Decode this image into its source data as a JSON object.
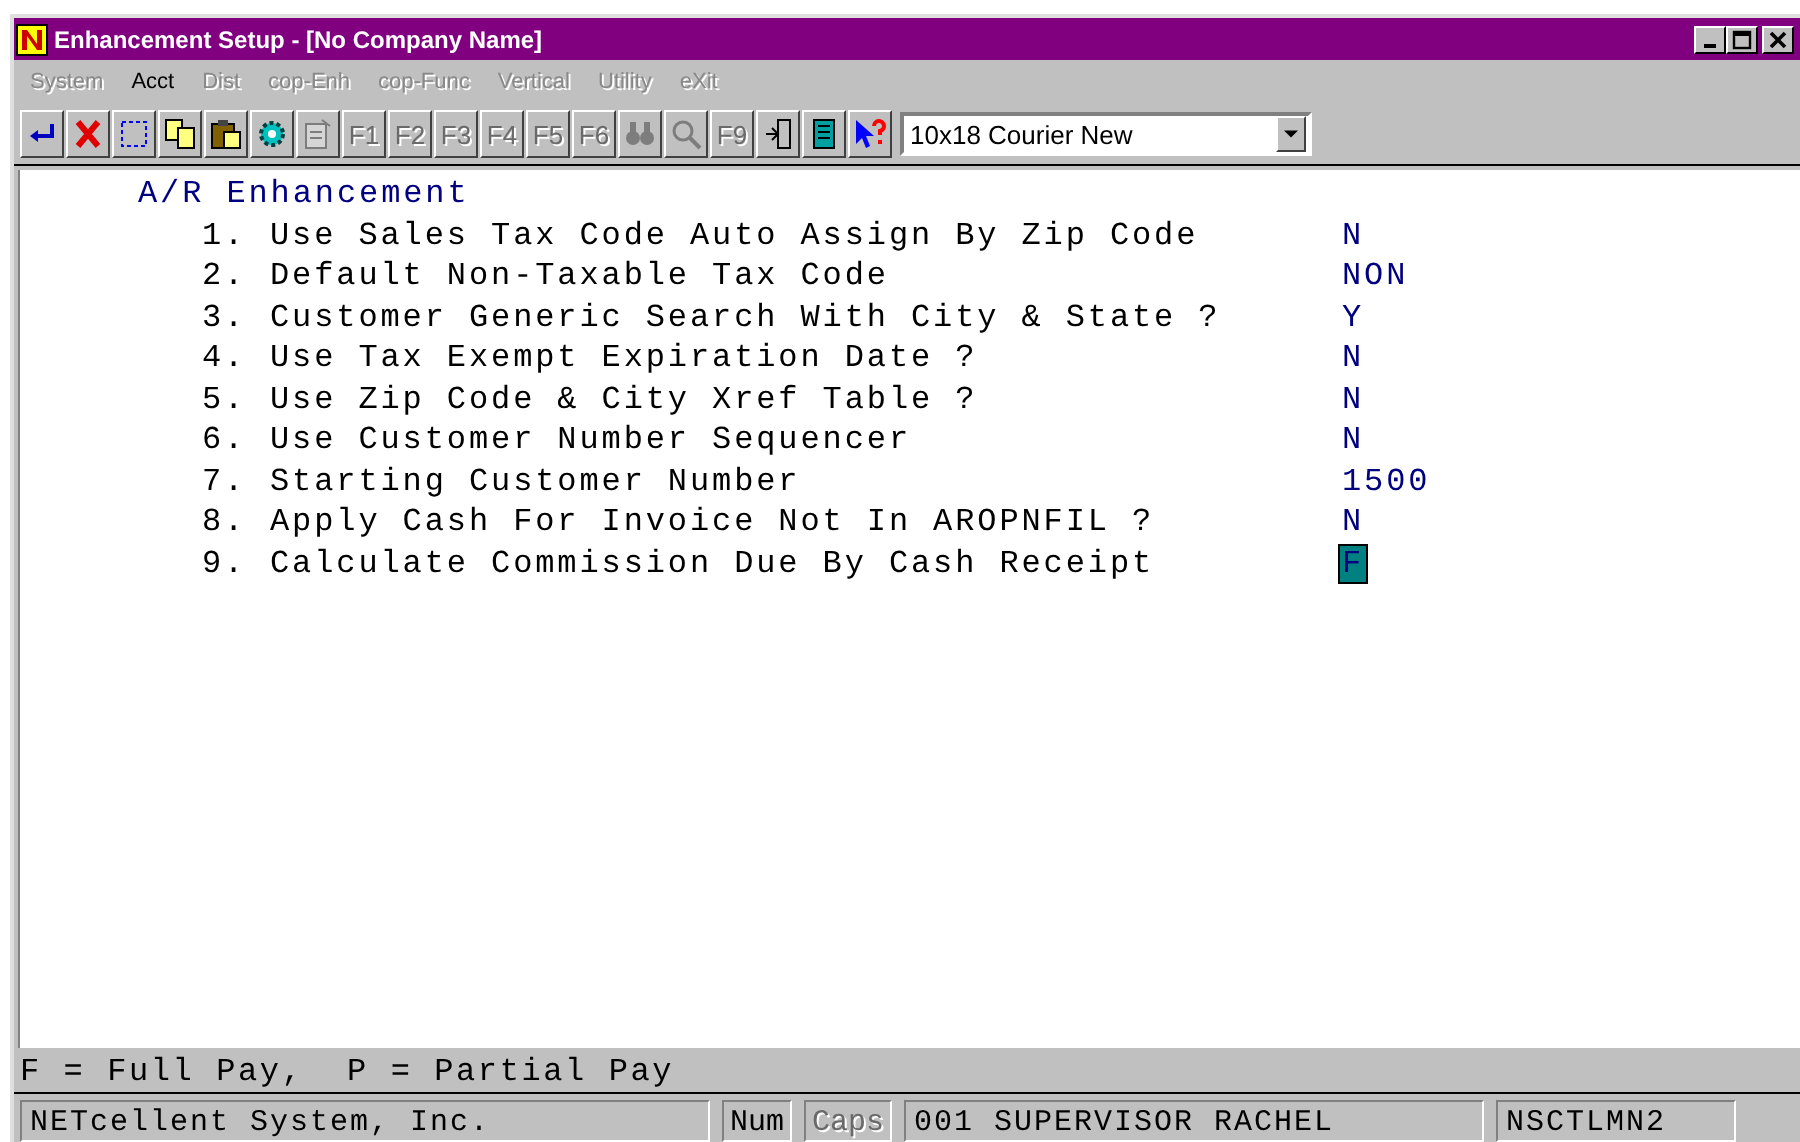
{
  "window": {
    "title": "Enhancement Setup - [No Company Name]"
  },
  "menu": [
    {
      "label": "System",
      "disabled": true
    },
    {
      "label": "Acct",
      "disabled": false
    },
    {
      "label": "Dist",
      "disabled": true
    },
    {
      "label": "cop-Enh",
      "disabled": true
    },
    {
      "label": "cop-Func",
      "disabled": true
    },
    {
      "label": "Vertical",
      "disabled": true
    },
    {
      "label": "Utility",
      "disabled": true
    },
    {
      "label": "eXit",
      "disabled": true
    }
  ],
  "toolbar": [
    {
      "kind": "enter",
      "disabled": false
    },
    {
      "kind": "cancel",
      "disabled": false
    },
    {
      "kind": "select",
      "disabled": false
    },
    {
      "kind": "copy",
      "disabled": false
    },
    {
      "kind": "paste",
      "disabled": false
    },
    {
      "kind": "gear",
      "disabled": false
    },
    {
      "kind": "document",
      "disabled": true
    },
    {
      "kind": "key",
      "label": "F1",
      "disabled": true
    },
    {
      "kind": "key",
      "label": "F2",
      "disabled": true
    },
    {
      "kind": "key",
      "label": "F3",
      "disabled": true
    },
    {
      "kind": "key",
      "label": "F4",
      "disabled": true
    },
    {
      "kind": "key",
      "label": "F5",
      "disabled": true
    },
    {
      "kind": "key",
      "label": "F6",
      "disabled": true
    },
    {
      "kind": "binoculars",
      "disabled": true
    },
    {
      "kind": "magnifier",
      "disabled": true
    },
    {
      "kind": "key",
      "label": "F9",
      "disabled": true
    },
    {
      "kind": "exit",
      "disabled": false
    },
    {
      "kind": "notebook",
      "disabled": false
    },
    {
      "kind": "help",
      "disabled": false
    }
  ],
  "font_select": {
    "value": "10x18 Courier New"
  },
  "form": {
    "heading": "A/R Enhancement",
    "fields": [
      {
        "number": "1.",
        "label": "Use Sales Tax Code Auto Assign By Zip Code",
        "value": "N",
        "selected": false
      },
      {
        "number": "2.",
        "label": "Default Non-Taxable Tax Code",
        "value": "NON",
        "selected": false
      },
      {
        "number": "3.",
        "label": "Customer Generic Search With City & State ?",
        "value": "Y",
        "selected": false
      },
      {
        "number": "4.",
        "label": "Use Tax Exempt Expiration Date ?",
        "value": "N",
        "selected": false
      },
      {
        "number": "5.",
        "label": "Use Zip Code & City Xref Table ?",
        "value": "N",
        "selected": false
      },
      {
        "number": "6.",
        "label": "Use Customer Number Sequencer",
        "value": "N",
        "selected": false
      },
      {
        "number": "7.",
        "label": "Starting Customer Number",
        "value": "1500",
        "selected": false
      },
      {
        "number": "8.",
        "label": "Apply Cash For Invoice Not In AROPNFIL ?",
        "value": "N",
        "selected": false
      },
      {
        "number": "9.",
        "label": "Calculate Commission Due By Cash Receipt",
        "value": "F",
        "selected": true
      }
    ]
  },
  "hint": "F = Full Pay,  P = Partial Pay",
  "status_bar": [
    {
      "text": "NETcellent System, Inc.",
      "kind": "company",
      "disabled": false
    },
    {
      "text": "Num",
      "kind": "indicator",
      "disabled": false
    },
    {
      "text": "Caps",
      "kind": "indicator",
      "disabled": true
    },
    {
      "text": "001 SUPERVISOR RACHEL",
      "kind": "user",
      "disabled": false
    },
    {
      "text": "NSCTLMN2",
      "kind": "program",
      "disabled": false
    }
  ]
}
